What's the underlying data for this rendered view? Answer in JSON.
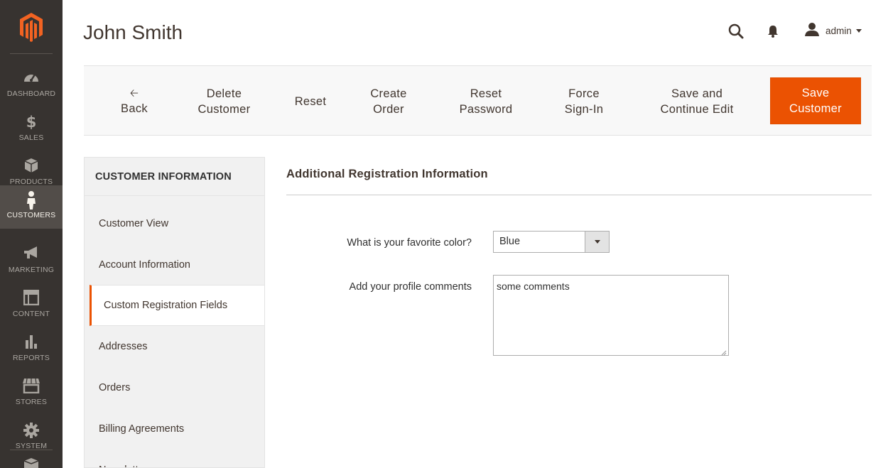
{
  "admin_menu": {
    "items": [
      {
        "label": "DASHBOARD",
        "icon": "dashboard-icon"
      },
      {
        "label": "SALES",
        "icon": "dollar-icon"
      },
      {
        "label": "PRODUCTS",
        "icon": "box-icon"
      },
      {
        "label": "CUSTOMERS",
        "icon": "person-icon",
        "active": true
      },
      {
        "label": "MARKETING",
        "icon": "megaphone-icon"
      },
      {
        "label": "CONTENT",
        "icon": "layout-icon"
      },
      {
        "label": "REPORTS",
        "icon": "bar-chart-icon"
      },
      {
        "label": "STORES",
        "icon": "store-icon"
      },
      {
        "label": "SYSTEM",
        "icon": "gear-icon"
      }
    ]
  },
  "header": {
    "title": "John Smith",
    "user": "admin"
  },
  "actions": {
    "back": "Back",
    "delete_customer": "Delete\nCustomer",
    "reset": "Reset",
    "create_order": "Create\nOrder",
    "reset_password": "Reset\nPassword",
    "force_sign_in": "Force\nSign-In",
    "save_and_continue": "Save and\nContinue Edit",
    "save_customer": "Save\nCustomer"
  },
  "tabs": {
    "title": "CUSTOMER INFORMATION",
    "items": [
      {
        "label": "Customer View"
      },
      {
        "label": "Account Information"
      },
      {
        "label": "Custom Registration Fields",
        "active": true
      },
      {
        "label": "Addresses"
      },
      {
        "label": "Orders"
      },
      {
        "label": "Billing Agreements"
      },
      {
        "label": "Newsletter"
      }
    ]
  },
  "form": {
    "section_title": "Additional Registration Information",
    "favorite_color_label": "What is your favorite color?",
    "favorite_color_value": "Blue",
    "profile_comments_label": "Add your profile comments",
    "profile_comments_value": "some comments"
  },
  "colors": {
    "menu_bg": "#373330",
    "menu_active_bg": "#524d49",
    "accent": "#eb5202",
    "logo": "#f26322"
  }
}
